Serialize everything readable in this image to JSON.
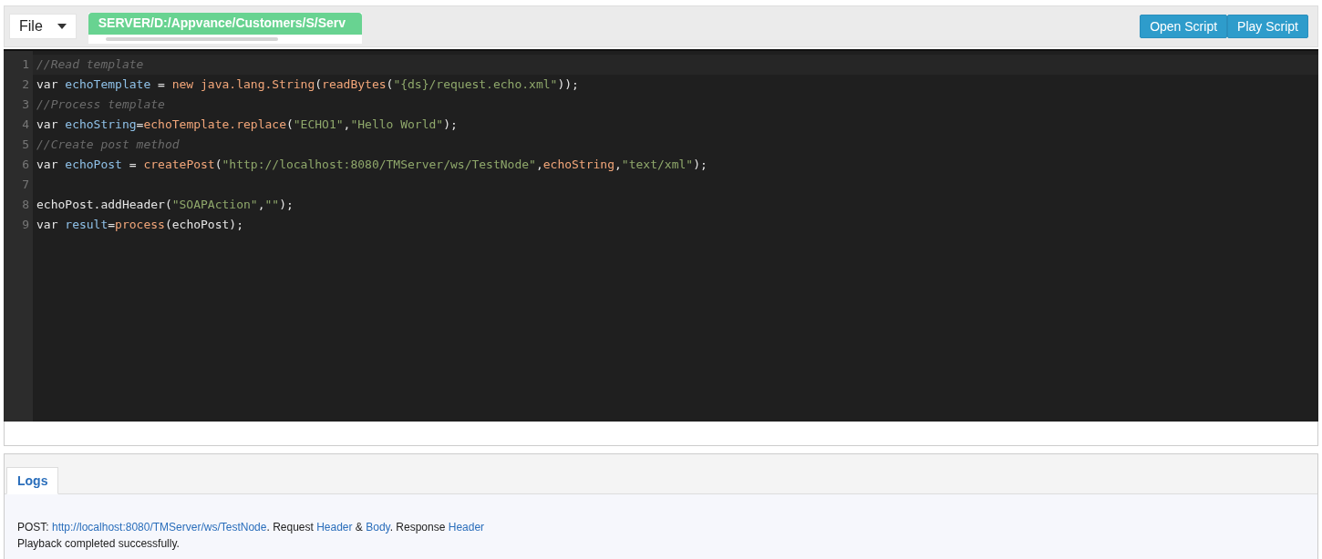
{
  "toolbar": {
    "file_menu": "File",
    "path": "SERVER/D:/Appvance/Customers/S/Serv",
    "buttons": [
      "Open Script",
      "Play Script"
    ]
  },
  "editor": {
    "lines": [
      {
        "number": "1",
        "tokens": [
          {
            "kind": "comment",
            "text": "//Read template"
          }
        ]
      },
      {
        "number": "2",
        "tokens": [
          {
            "kind": "plain",
            "text": "var "
          },
          {
            "kind": "var",
            "text": "echoTemplate"
          },
          {
            "kind": "plain",
            "text": " = "
          },
          {
            "kind": "call",
            "text": "new java.lang.String"
          },
          {
            "kind": "plain",
            "text": "("
          },
          {
            "kind": "call",
            "text": "readBytes"
          },
          {
            "kind": "plain",
            "text": "("
          },
          {
            "kind": "string",
            "text": "\"{ds}/request.echo.xml\""
          },
          {
            "kind": "plain",
            "text": "));"
          }
        ]
      },
      {
        "number": "3",
        "tokens": [
          {
            "kind": "comment",
            "text": "//Process template"
          }
        ]
      },
      {
        "number": "4",
        "tokens": [
          {
            "kind": "plain",
            "text": "var "
          },
          {
            "kind": "var",
            "text": "echoString"
          },
          {
            "kind": "plain",
            "text": "="
          },
          {
            "kind": "call",
            "text": "echoTemplate.replace"
          },
          {
            "kind": "plain",
            "text": "("
          },
          {
            "kind": "string",
            "text": "\"ECHO1\""
          },
          {
            "kind": "plain",
            "text": ","
          },
          {
            "kind": "string",
            "text": "\"Hello World\""
          },
          {
            "kind": "plain",
            "text": ");"
          }
        ]
      },
      {
        "number": "5",
        "tokens": [
          {
            "kind": "comment",
            "text": "//Create post method"
          }
        ]
      },
      {
        "number": "6",
        "tokens": [
          {
            "kind": "plain",
            "text": "var "
          },
          {
            "kind": "var",
            "text": "echoPost"
          },
          {
            "kind": "plain",
            "text": " = "
          },
          {
            "kind": "call",
            "text": "createPost"
          },
          {
            "kind": "plain",
            "text": "("
          },
          {
            "kind": "string",
            "text": "\"http://localhost:8080/TMServer/ws/TestNode\""
          },
          {
            "kind": "plain",
            "text": ","
          },
          {
            "kind": "call",
            "text": "echoString"
          },
          {
            "kind": "plain",
            "text": ","
          },
          {
            "kind": "string",
            "text": "\"text/xml\""
          },
          {
            "kind": "plain",
            "text": ");"
          }
        ]
      },
      {
        "number": "7"
      },
      {
        "number": "8",
        "tokens": [
          {
            "kind": "plain",
            "text": "echoPost.addHeader("
          },
          {
            "kind": "string",
            "text": "\"SOAPAction\""
          },
          {
            "kind": "plain",
            "text": ","
          },
          {
            "kind": "string",
            "text": "\"\""
          },
          {
            "kind": "plain",
            "text": ");"
          }
        ]
      },
      {
        "number": "9",
        "tokens": [
          {
            "kind": "plain",
            "text": "var "
          },
          {
            "kind": "var",
            "text": "result"
          },
          {
            "kind": "plain",
            "text": "="
          },
          {
            "kind": "call",
            "text": "process"
          },
          {
            "kind": "plain",
            "text": "(echoPost);"
          }
        ]
      }
    ]
  },
  "logs": {
    "tabs": [
      {
        "label": "Logs",
        "selected": true
      }
    ],
    "entries": [
      [
        {
          "kind": "text",
          "text": "POST: "
        },
        {
          "kind": "link",
          "text": "http://localhost:8080/TMServer/ws/TestNode"
        },
        {
          "kind": "text",
          "text": ". Request "
        },
        {
          "kind": "link",
          "text": "Header"
        },
        {
          "kind": "text",
          "text": " & "
        },
        {
          "kind": "link",
          "text": "Body"
        },
        {
          "kind": "text",
          "text": ". Response "
        },
        {
          "kind": "link",
          "text": "Header"
        }
      ],
      [
        {
          "kind": "text",
          "text": "Playback completed successfully."
        }
      ]
    ]
  }
}
